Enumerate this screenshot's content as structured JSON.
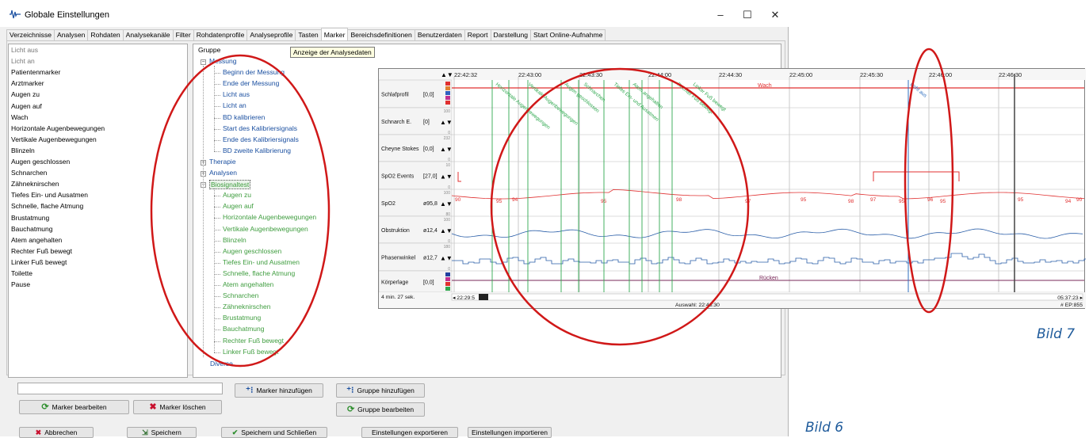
{
  "window": {
    "title": "Globale Einstellungen",
    "minimize": "–",
    "maximize": "☐",
    "close": "✕"
  },
  "tabs": [
    "Verzeichnisse",
    "Analysen",
    "Rohdaten",
    "Analysekanäle",
    "Filter",
    "Rohdatenprofile",
    "Analyseprofile",
    "Tasten",
    "Marker",
    "Bereichsdefinitionen",
    "Benutzerdaten",
    "Report",
    "Darstellung",
    "Start Online-Aufnahme"
  ],
  "active_tab": "Marker",
  "tooltip": "Anzeige der Analysedaten",
  "marker_list": [
    "Licht aus",
    "Licht an",
    "Patientenmarker",
    "Arztmarker",
    "Augen zu",
    "Augen auf",
    "Wach",
    "Horizontale Augenbewegungen",
    "Vertikale Augenbewegungen",
    "Blinzeln",
    "Augen geschlossen",
    "Schnarchen",
    "Zähneknirschen",
    "Tiefes Ein- und Ausatmen",
    "Schnelle, flache Atmung",
    "Brustatmung",
    "Bauchatmung",
    "Atem angehalten",
    "Rechter Fuß bewegt",
    "Linker Fuß bewegt",
    "Toilette",
    "Pause"
  ],
  "tree": {
    "header": "Gruppe",
    "messung": {
      "label": "Messung",
      "children": [
        "Beginn der Messung",
        "Ende der Messung",
        "Licht aus",
        "Licht an",
        "BD kalibrieren",
        "Start des Kalibriersignals",
        "Ende des Kalibriersignals",
        "BD zweite Kalibrierung"
      ]
    },
    "therapie": "Therapie",
    "analysen": "Analysen",
    "biosignaltest": {
      "label": "Biosignaltest",
      "children": [
        "Augen zu",
        "Augen auf",
        "Horizontale Augenbewegungen",
        "Vertikale Augenbewegungen",
        "Blinzeln",
        "Augen geschlossen",
        "Tiefes Ein- und Ausatmen",
        "Schnelle, flache Atmung",
        "Atem angehalten",
        "Schnarchen",
        "Zähneknirschen",
        "Brustatmung",
        "Bauchatmung",
        "Rechter Fuß bewegt",
        "Linker Fuß bewegt"
      ]
    },
    "diverse": "Diverse"
  },
  "buttons": {
    "marker_hinzufuegen": "Marker hinzufügen",
    "gruppe_hinzufuegen": "Gruppe hinzufügen",
    "marker_bearbeiten": "Marker bearbeiten",
    "marker_loeschen": "Marker löschen",
    "gruppe_bearbeiten": "Gruppe bearbeiten",
    "abbrechen": "Abbrechen",
    "speichern": "Speichern",
    "speichern_schliessen": "Speichern und Schließen",
    "einstellungen_exportieren": "Einstellungen exportieren",
    "einstellungen_importieren": "Einstellungen importieren"
  },
  "icon_colors": {
    "refresh": "#2f8f2f",
    "delete": "#c8102e",
    "add": "#1a4fa0",
    "check": "#2f8f2f"
  },
  "chart": {
    "time_ticks": [
      "22:42:32",
      "22:43:00",
      "22:43:30",
      "22:44:00",
      "22:44:30",
      "22:45:00",
      "22:45:30",
      "22:46:00",
      "22:46:30"
    ],
    "channels": [
      {
        "name": "Schlafprofil",
        "value": "[0,0]",
        "scale_top": "",
        "scale_bottom": ""
      },
      {
        "name": "Schnarch E.",
        "value": "[0]",
        "scale_top": "100",
        "scale_bottom": "0"
      },
      {
        "name": "Cheyne Stokes",
        "value": "[0,0]",
        "scale_top": "232",
        "scale_bottom": "0"
      },
      {
        "name": "SpO2 Events",
        "value": "[27,0]",
        "scale_top": "10",
        "scale_bottom": "0"
      },
      {
        "name": "SpO2",
        "value": "ø95,8",
        "scale_top": "100",
        "scale_bottom": "80"
      },
      {
        "name": "Obstruktion",
        "value": "ø12,4",
        "scale_top": "100",
        "scale_bottom": "0"
      },
      {
        "name": "Phasenwinkel",
        "value": "ø12,7",
        "scale_top": "180",
        "scale_bottom": "0"
      },
      {
        "name": "Körperlage",
        "value": "[0,0]",
        "scale_top": "",
        "scale_bottom": ""
      }
    ],
    "sleep_label": "Wach",
    "position_label": "Rücken",
    "spo2_values": [
      "90",
      "95",
      "94",
      "95",
      "98",
      "97",
      "95",
      "98",
      "97",
      "95",
      "96",
      "95",
      "95",
      "94",
      "90"
    ],
    "marker_labels": [
      "Horizontale Augenbewegungen",
      "Vertikale Augenbewegungen",
      "Augen geschlossen",
      "Schnarchen",
      "Tiefes Ein- und Ausatmen",
      "Atem angehalten",
      "Rechter Fuß bewegt",
      "Linker Fuß bewegt",
      "Licht aus"
    ],
    "duration": "4 min. 27 sek.",
    "scroll_start": "22:29:5",
    "scroll_end": "05:37:23",
    "selection": "Auswahl: 22:46:30",
    "epoch": "# EP:855",
    "colors": {
      "sleep": "#e03030",
      "spo2": "#e03030",
      "obstruction": "#2a5ea8",
      "markers": "#2fa84f",
      "highlight": "#2f6fbf",
      "annotation": "#d01818"
    }
  },
  "captions": {
    "bild6": "Bild 6",
    "bild7": "Bild 7"
  }
}
